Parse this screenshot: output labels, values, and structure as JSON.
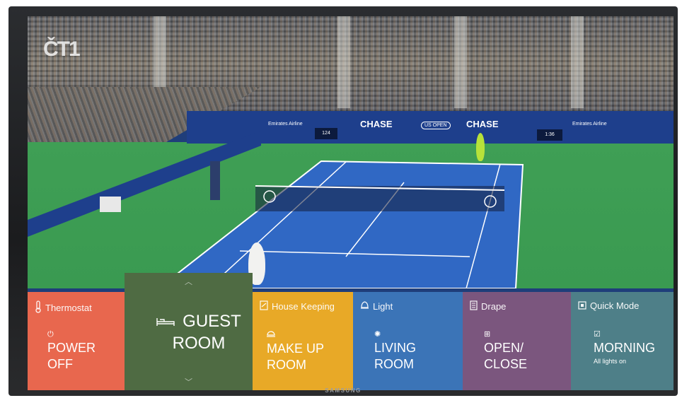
{
  "tv": {
    "brand": "SAMSUNG"
  },
  "broadcast": {
    "channel_logo": "ČT1",
    "ads": [
      "Emirates Airline",
      "CHASE",
      "US OPEN",
      "CHASE",
      "Emirates Airline"
    ],
    "score_left": "124",
    "score_right": "1:36"
  },
  "tiles": {
    "thermostat": {
      "title": "Thermostat",
      "icon": "thermometer-icon",
      "glyph": "power-icon",
      "line1": "POWER",
      "line2": "OFF",
      "color": "#e8674e"
    },
    "guest_room": {
      "icon": "bed-icon",
      "line1": "GUEST",
      "line2": "ROOM",
      "color": "#4f6b43"
    },
    "house_keeping": {
      "title": "House Keeping",
      "icon": "clipboard-icon",
      "glyph": "room-service-icon",
      "line1": "MAKE UP",
      "line2": "ROOM",
      "color": "#e8a927"
    },
    "light": {
      "title": "Light",
      "icon": "bell-icon",
      "glyph": "light-bulb-icon",
      "line1": "LIVING",
      "line2": "ROOM",
      "color": "#3b74b7"
    },
    "drape": {
      "title": "Drape",
      "icon": "drape-icon",
      "glyph": "grid-icon",
      "line1": "OPEN/",
      "line2": "CLOSE",
      "color": "#7b567e"
    },
    "quick_mode": {
      "title": "Quick Mode",
      "icon": "mode-icon",
      "glyph": "checkbox-icon",
      "line1": "MORNING",
      "sub": "All lights on",
      "color": "#4e7f88"
    }
  }
}
